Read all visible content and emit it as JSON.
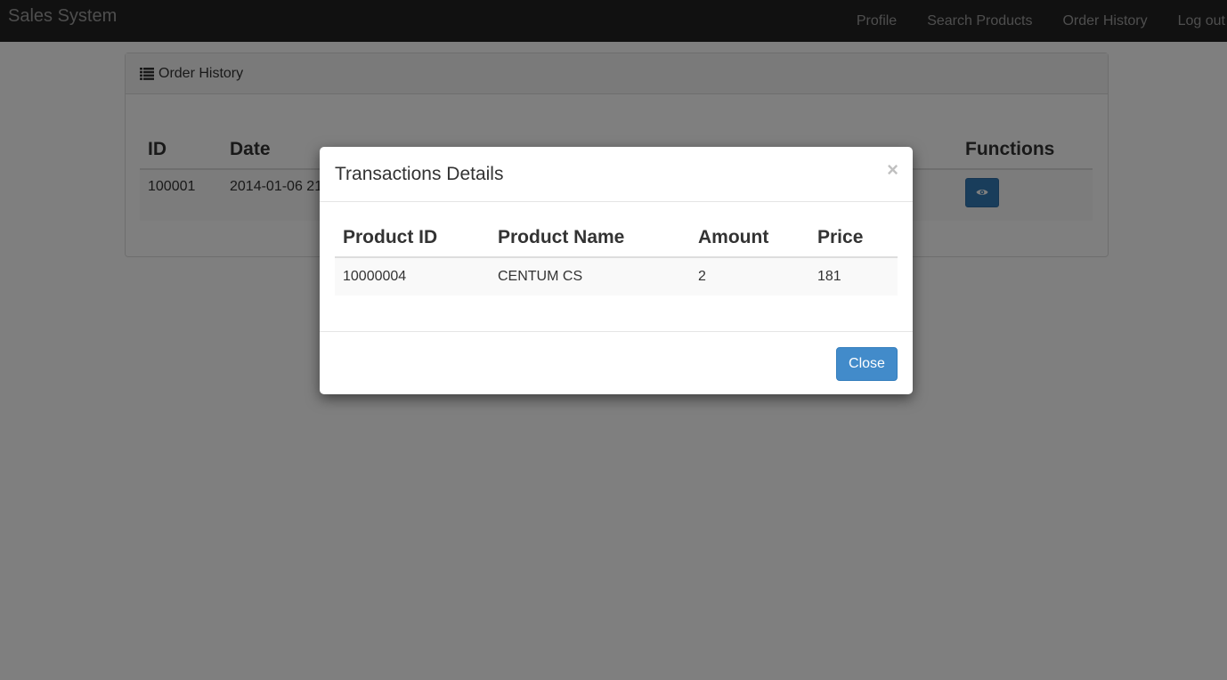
{
  "navbar": {
    "brand": "Sales System",
    "links": [
      "Profile",
      "Search Products",
      "Order History",
      "Log out"
    ]
  },
  "panel": {
    "icon": "list-icon",
    "title": "Order History",
    "columns": [
      "ID",
      "Date",
      "Functions"
    ],
    "rows": [
      {
        "id": "100001",
        "date": "2014-01-06 21"
      }
    ]
  },
  "modal": {
    "title": "Transactions Details",
    "close_symbol": "×",
    "columns": [
      "Product ID",
      "Product Name",
      "Amount",
      "Price"
    ],
    "rows": [
      {
        "product_id": "10000004",
        "product_name": "CENTUM CS",
        "amount": "2",
        "price": "181"
      }
    ],
    "close_label": "Close"
  },
  "colors": {
    "navbar": "#222222",
    "primary": "#428bca",
    "view_button": "#337ab7",
    "backdrop": "rgba(0,0,0,0.5)"
  }
}
